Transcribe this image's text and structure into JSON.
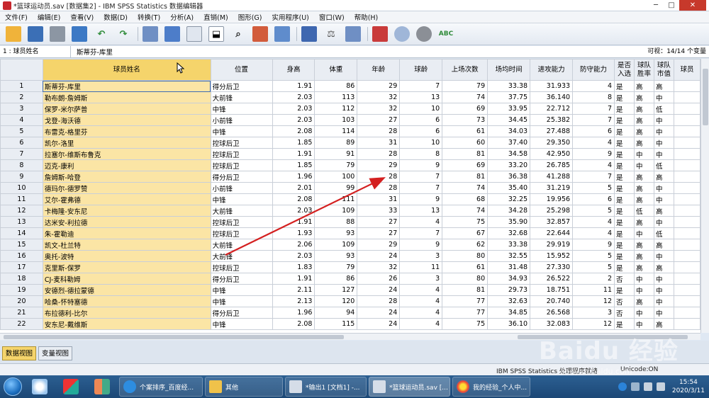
{
  "window": {
    "title": "*篮球运动员.sav [数据集2] - IBM SPSS Statistics 数据编辑器",
    "minimize": "─",
    "maximize": "□",
    "close": "✕"
  },
  "menu": [
    "文件(F)",
    "编辑(E)",
    "查看(V)",
    "数据(D)",
    "转换(T)",
    "分析(A)",
    "直销(M)",
    "图形(G)",
    "实用程序(U)",
    "窗口(W)",
    "帮助(H)"
  ],
  "toolbar_icons": [
    "open-folder-icon",
    "save-icon",
    "print-icon",
    "recall-dialog-icon",
    "undo-icon",
    "redo-icon",
    "goto-case-icon",
    "goto-variable-icon",
    "variables-icon",
    "find-icon",
    "insert-cases-icon",
    "insert-variable-icon",
    "split-file-icon",
    "weight-cases-icon",
    "select-cases-icon",
    "value-labels-icon",
    "use-sets-icon",
    "show-all-icon",
    "spell-check-icon"
  ],
  "editor": {
    "cell_ref": "1 : 球员姓名",
    "cell_value": "斯蒂芬-库里",
    "visible": "可视：14/14 个变量"
  },
  "grid": {
    "columns": [
      "球员姓名",
      "位置",
      "身高",
      "体重",
      "年龄",
      "球龄",
      "上场次数",
      "场均时间",
      "进攻能力",
      "防守能力",
      "是否入选",
      "球队胜率",
      "球队市值",
      "球员"
    ],
    "rows": [
      [
        "1",
        "斯蒂芬-库里",
        "得分后卫",
        "1.91",
        "86",
        "29",
        "7",
        "79",
        "33.38",
        "31.933",
        "4",
        "是",
        "高",
        "高"
      ],
      [
        "2",
        "勒布朗-詹姆斯",
        "大前锋",
        "2.03",
        "113",
        "32",
        "13",
        "74",
        "37.75",
        "36.140",
        "8",
        "是",
        "高",
        "中"
      ],
      [
        "3",
        "保罗-米尔萨普",
        "中锋",
        "2.03",
        "112",
        "32",
        "10",
        "69",
        "33.95",
        "22.712",
        "7",
        "是",
        "高",
        "低"
      ],
      [
        "4",
        "戈登-海沃德",
        "小前锋",
        "2.03",
        "103",
        "27",
        "6",
        "73",
        "34.45",
        "25.382",
        "7",
        "是",
        "高",
        "中"
      ],
      [
        "5",
        "布雷克-格里芬",
        "中锋",
        "2.08",
        "114",
        "28",
        "6",
        "61",
        "34.03",
        "27.488",
        "6",
        "是",
        "高",
        "中"
      ],
      [
        "6",
        "凯尔-洛里",
        "控球后卫",
        "1.85",
        "89",
        "31",
        "10",
        "60",
        "37.40",
        "29.350",
        "4",
        "是",
        "高",
        "中"
      ],
      [
        "7",
        "拉塞尔-维斯布鲁克",
        "控球后卫",
        "1.91",
        "91",
        "28",
        "8",
        "81",
        "34.58",
        "42.950",
        "9",
        "是",
        "中",
        "中"
      ],
      [
        "8",
        "迈克-康利",
        "控球后卫",
        "1.85",
        "79",
        "29",
        "9",
        "69",
        "33.20",
        "26.785",
        "4",
        "是",
        "中",
        "低"
      ],
      [
        "9",
        "詹姆斯-哈登",
        "得分后卫",
        "1.96",
        "100",
        "28",
        "7",
        "81",
        "36.38",
        "41.288",
        "7",
        "是",
        "高",
        "高"
      ],
      [
        "10",
        "德玛尔-德罗赞",
        "小前锋",
        "2.01",
        "99",
        "28",
        "7",
        "74",
        "35.40",
        "31.219",
        "5",
        "是",
        "高",
        "中"
      ],
      [
        "11",
        "艾尔-霍弗德",
        "中锋",
        "2.08",
        "111",
        "31",
        "9",
        "68",
        "32.25",
        "19.956",
        "6",
        "是",
        "高",
        "中"
      ],
      [
        "12",
        "卡梅隆-安东尼",
        "大前锋",
        "2.03",
        "109",
        "33",
        "13",
        "74",
        "34.28",
        "25.298",
        "5",
        "是",
        "低",
        "高"
      ],
      [
        "13",
        "达米安-利拉德",
        "控球后卫",
        "1.91",
        "88",
        "27",
        "4",
        "75",
        "35.90",
        "32.857",
        "4",
        "是",
        "高",
        "中"
      ],
      [
        "14",
        "朱-霍勒迪",
        "控球后卫",
        "1.93",
        "93",
        "27",
        "7",
        "67",
        "32.68",
        "22.644",
        "4",
        "是",
        "中",
        "低"
      ],
      [
        "15",
        "凯文-杜兰特",
        "大前锋",
        "2.06",
        "109",
        "29",
        "9",
        "62",
        "33.38",
        "29.919",
        "9",
        "是",
        "高",
        "高"
      ],
      [
        "16",
        "奥托-波特",
        "大前锋",
        "2.03",
        "93",
        "24",
        "3",
        "80",
        "32.55",
        "15.952",
        "5",
        "是",
        "高",
        "中"
      ],
      [
        "17",
        "克里斯-保罗",
        "控球后卫",
        "1.83",
        "79",
        "32",
        "11",
        "61",
        "31.48",
        "27.330",
        "5",
        "是",
        "高",
        "高"
      ],
      [
        "18",
        "CJ-麦科勒姆",
        "得分后卫",
        "1.91",
        "86",
        "26",
        "3",
        "80",
        "34.93",
        "26.522",
        "2",
        "否",
        "中",
        "中"
      ],
      [
        "19",
        "安德烈-德拉蒙德",
        "中锋",
        "2.11",
        "127",
        "24",
        "4",
        "81",
        "29.73",
        "18.751",
        "11",
        "是",
        "中",
        "中"
      ],
      [
        "20",
        "哈桑-怀特塞德",
        "中锋",
        "2.13",
        "120",
        "28",
        "4",
        "77",
        "32.63",
        "20.740",
        "12",
        "否",
        "高",
        "中"
      ],
      [
        "21",
        "布拉德利-比尔",
        "得分后卫",
        "1.96",
        "94",
        "24",
        "4",
        "77",
        "34.85",
        "26.568",
        "3",
        "否",
        "中",
        "中"
      ],
      [
        "22",
        "安东尼-戴维斯",
        "中锋",
        "2.08",
        "115",
        "24",
        "4",
        "75",
        "36.10",
        "32.083",
        "12",
        "是",
        "中",
        "高"
      ]
    ]
  },
  "view_tabs": [
    "数据视图",
    "变量视图"
  ],
  "status": {
    "processor": "IBM SPSS Statistics 处理程序就绪",
    "encoding": "Unicode:ON"
  },
  "taskbar": {
    "tasks": [
      "个案排序_百度经...",
      "其他",
      "*输出1 [文档1] -...",
      "*篮球运动员.sav [...",
      "我的经验_个人中..."
    ],
    "time": "15:54",
    "date": "2020/3/11"
  },
  "watermark": "Baidu 经验",
  "watermark_sub": "jingyan.baidu.com",
  "colors": {
    "name_column": "#fbe5a5",
    "active_tab": "#f5d46b",
    "annotation_arrow": "#d42020",
    "taskbar": "#1c4876"
  }
}
